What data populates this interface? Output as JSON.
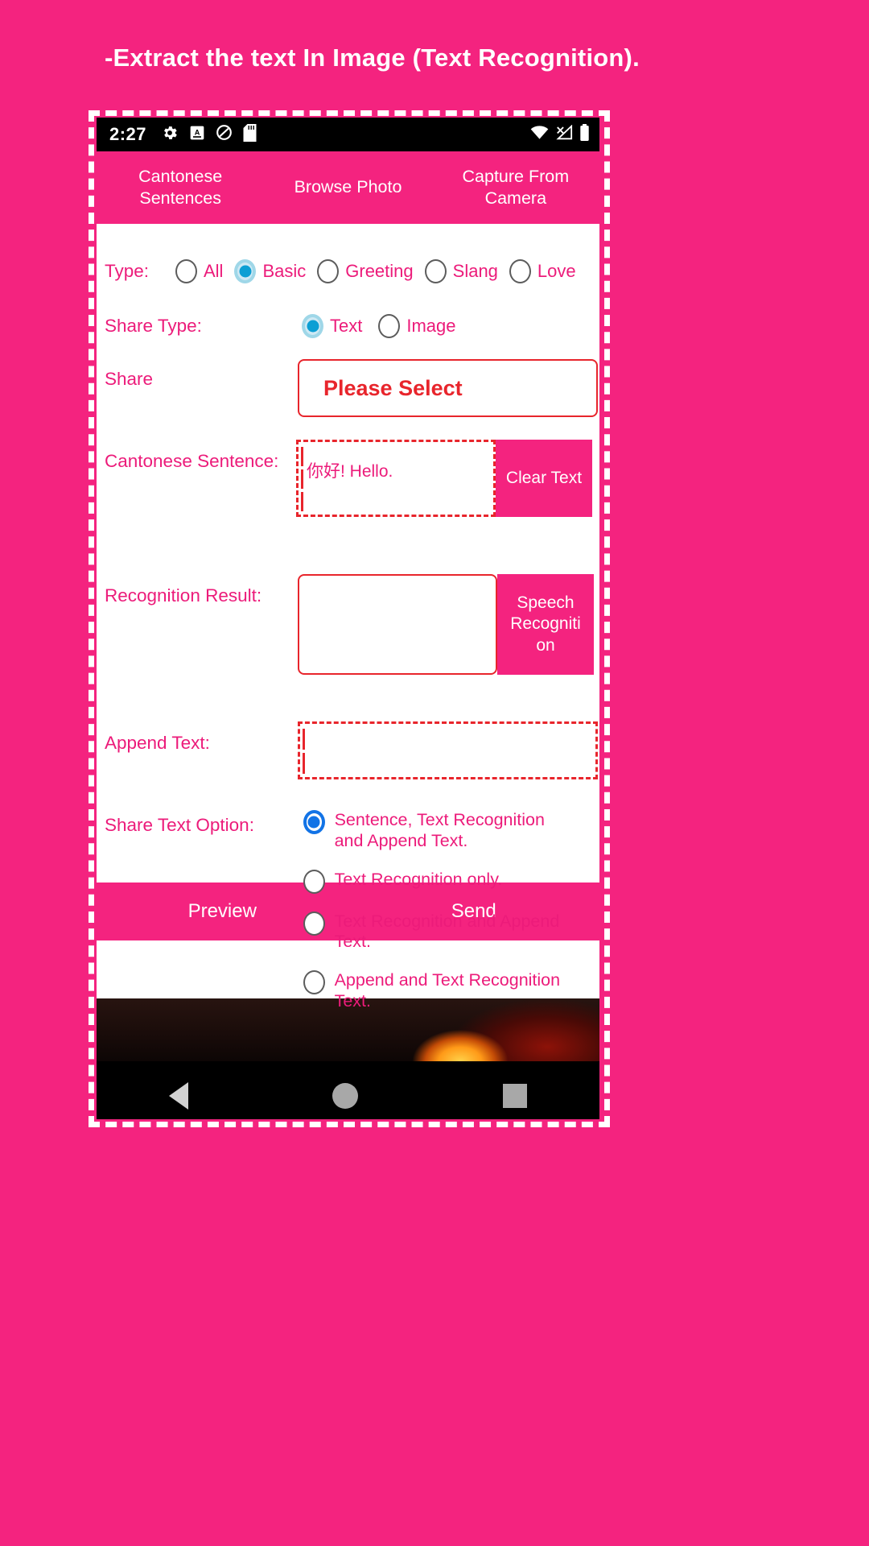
{
  "caption": "-Extract the text In Image (Text Recognition).",
  "colors": {
    "brand_pink": "#f4237f",
    "label_pink": "#ec1b7a",
    "accent_red": "#e8252c",
    "radio_blue": "#1273e6",
    "radio_teal": "#0c9fd4",
    "white": "#ffffff",
    "black": "#000000"
  },
  "statusbar": {
    "time": "2:27",
    "left_icons": [
      "gear-icon",
      "a-badge-icon",
      "do-not-disturb-icon",
      "sd-card-icon"
    ],
    "right_icons": [
      "wifi-icon",
      "signal-off-icon",
      "battery-icon"
    ]
  },
  "tabs": [
    {
      "label": "Cantonese\nSentences",
      "selected": true
    },
    {
      "label": "Browse Photo",
      "selected": false
    },
    {
      "label": "Capture From\nCamera",
      "selected": false
    }
  ],
  "form": {
    "type": {
      "label": "Type:",
      "options": [
        {
          "label": "All",
          "selected": false
        },
        {
          "label": "Basic",
          "selected": true
        },
        {
          "label": "Greeting",
          "selected": false
        },
        {
          "label": "Slang",
          "selected": false
        },
        {
          "label": "Love",
          "selected": false
        }
      ]
    },
    "share_type": {
      "label": "Share Type:",
      "options": [
        {
          "label": "Text",
          "selected": true
        },
        {
          "label": "Image",
          "selected": false
        }
      ]
    },
    "share": {
      "label": "Share",
      "select_value": "Please Select"
    },
    "cantonese_sentence": {
      "label": "Cantonese Sentence:",
      "value": "你好! Hello.",
      "button": "Clear Text"
    },
    "recognition_result": {
      "label": "Recognition Result:",
      "value": "",
      "button": "Speech Recogniti on"
    },
    "append_text": {
      "label": "Append Text:",
      "value": ""
    },
    "share_text_option": {
      "label": "Share Text Option:",
      "options": [
        {
          "label": "Sentence, Text Recognition\nand Append Text.",
          "selected": true
        },
        {
          "label": "Text Recognition only.",
          "selected": false
        },
        {
          "label": "Text Recognition and Append Text.",
          "selected": false
        },
        {
          "label": "Append and Text Recognition Text.",
          "selected": false
        }
      ]
    }
  },
  "actions": [
    {
      "label": "Preview"
    },
    {
      "label": "Send"
    }
  ],
  "navbar": {
    "back": "back-triangle-icon",
    "home": "home-circle-icon",
    "recents": "recents-square-icon"
  }
}
